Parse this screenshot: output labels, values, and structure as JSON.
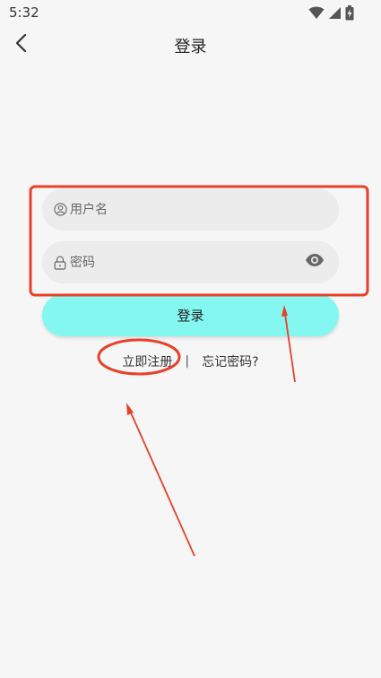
{
  "status_bar": {
    "time": "5:32",
    "icons": [
      "wifi-icon",
      "signal-icon",
      "battery-charging-icon"
    ]
  },
  "app_bar": {
    "title": "登录",
    "back_icon": "chevron-left-icon"
  },
  "form": {
    "username": {
      "placeholder": "用户名",
      "value": "",
      "icon": "user-icon"
    },
    "password": {
      "placeholder": "密码",
      "value": "",
      "icon": "lock-icon",
      "toggle_icon": "eye-icon"
    },
    "login_label": "登录",
    "login_color": "#84f8f0"
  },
  "links": {
    "register": "立即注册",
    "separator": "|",
    "forgot": "忘记密码?"
  },
  "annotation_color": "#e8402a"
}
